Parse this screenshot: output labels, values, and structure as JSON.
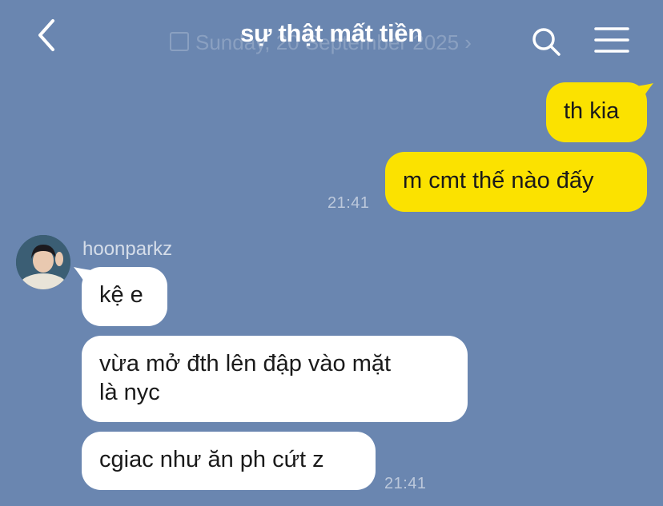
{
  "header": {
    "title": "sự thật mất tiền",
    "date_ghost": "Sunday, 20 September 2025 ›",
    "back_icon": "chevron-left-icon",
    "search_icon": "search-icon",
    "menu_icon": "hamburger-menu-icon"
  },
  "colors": {
    "background": "#6a86b0",
    "my_bubble": "#fbe200",
    "their_bubble": "#ffffff"
  },
  "messages_out": [
    {
      "text": "th kia"
    },
    {
      "text": "m cmt thế nào đấy",
      "time": "21:41"
    }
  ],
  "contact": {
    "name": "hoonparkz",
    "avatar_icon": "avatar-photo"
  },
  "messages_in": [
    {
      "text": "kệ e"
    },
    {
      "line1": "vừa mở đth lên đập vào mặt",
      "line2": "là nyc"
    },
    {
      "text": "cgiac như ăn ph cứt z",
      "time": "21:41"
    }
  ]
}
